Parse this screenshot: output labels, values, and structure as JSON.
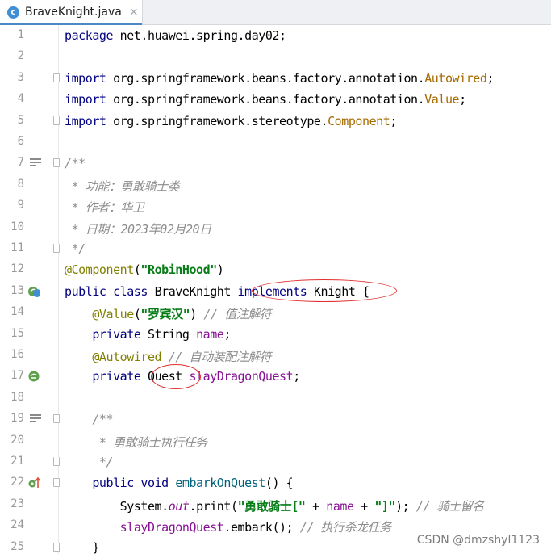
{
  "tab": {
    "icon_letter": "c",
    "filename": "BraveKnight.java",
    "close": "×"
  },
  "lines": [
    {
      "n": "1",
      "code": [
        [
          "kw",
          "package"
        ],
        [
          "plain",
          " net.huawei.spring.day02;"
        ]
      ]
    },
    {
      "n": "2",
      "code": []
    },
    {
      "n": "3",
      "code": [
        [
          "kw",
          "import"
        ],
        [
          "plain",
          " org.springframework.beans.factory.annotation."
        ],
        [
          "cls",
          "Autowired"
        ],
        [
          "plain",
          ";"
        ]
      ],
      "fold": "start"
    },
    {
      "n": "4",
      "code": [
        [
          "kw",
          "import"
        ],
        [
          "plain",
          " org.springframework.beans.factory.annotation."
        ],
        [
          "cls",
          "Value"
        ],
        [
          "plain",
          ";"
        ]
      ]
    },
    {
      "n": "5",
      "code": [
        [
          "kw",
          "import"
        ],
        [
          "plain",
          " org.springframework.stereotype."
        ],
        [
          "cls",
          "Component"
        ],
        [
          "plain",
          ";"
        ]
      ],
      "fold": "end"
    },
    {
      "n": "6",
      "code": []
    },
    {
      "n": "7",
      "code": [
        [
          "cmt",
          "/**"
        ]
      ],
      "fold": "start",
      "gutter": "doc"
    },
    {
      "n": "8",
      "code": [
        [
          "cmt",
          " * 功能：勇敢骑士类"
        ]
      ]
    },
    {
      "n": "9",
      "code": [
        [
          "cmt",
          " * 作者：华卫"
        ]
      ]
    },
    {
      "n": "10",
      "code": [
        [
          "cmt",
          " * 日期：2023年02月20日"
        ]
      ]
    },
    {
      "n": "11",
      "code": [
        [
          "cmt",
          " */"
        ]
      ],
      "fold": "end"
    },
    {
      "n": "12",
      "code": [
        [
          "ann",
          "@Component"
        ],
        [
          "plain",
          "("
        ],
        [
          "str",
          "\"RobinHood\""
        ],
        [
          "plain",
          ")"
        ]
      ]
    },
    {
      "n": "13",
      "code": [
        [
          "kw",
          "public class"
        ],
        [
          "plain",
          " BraveKnight "
        ],
        [
          "kw",
          "implements"
        ],
        [
          "plain",
          " Knight "
        ],
        [
          "plain",
          "{"
        ]
      ],
      "gutter": "impl"
    },
    {
      "n": "14",
      "code": [
        [
          "plain",
          "    "
        ],
        [
          "ann",
          "@Value"
        ],
        [
          "plain",
          "("
        ],
        [
          "str",
          "\"罗宾汉\""
        ],
        [
          "plain",
          ") "
        ],
        [
          "cmt",
          "// 值注解符"
        ]
      ]
    },
    {
      "n": "15",
      "code": [
        [
          "plain",
          "    "
        ],
        [
          "kw",
          "private"
        ],
        [
          "plain",
          " String "
        ],
        [
          "fld",
          "name"
        ],
        [
          "plain",
          ";"
        ]
      ]
    },
    {
      "n": "16",
      "code": [
        [
          "plain",
          "    "
        ],
        [
          "ann",
          "@Autowired"
        ],
        [
          "plain",
          " "
        ],
        [
          "cmt",
          "// 自动装配注解符"
        ]
      ]
    },
    {
      "n": "17",
      "code": [
        [
          "plain",
          "    "
        ],
        [
          "kw",
          "private"
        ],
        [
          "plain",
          " Quest "
        ],
        [
          "fld",
          "slayDragonQuest"
        ],
        [
          "plain",
          ";"
        ]
      ],
      "gutter": "bean"
    },
    {
      "n": "18",
      "code": []
    },
    {
      "n": "19",
      "code": [
        [
          "plain",
          "    "
        ],
        [
          "cmt",
          "/**"
        ]
      ],
      "fold": "start",
      "gutter": "doc"
    },
    {
      "n": "20",
      "code": [
        [
          "plain",
          "     "
        ],
        [
          "cmt",
          "* 勇敢骑士执行任务"
        ]
      ]
    },
    {
      "n": "21",
      "code": [
        [
          "plain",
          "     "
        ],
        [
          "cmt",
          "*/"
        ]
      ],
      "fold": "end"
    },
    {
      "n": "22",
      "code": [
        [
          "plain",
          "    "
        ],
        [
          "kw",
          "public void"
        ],
        [
          "plain",
          " "
        ],
        [
          "meth",
          "embarkOnQuest"
        ],
        [
          "plain",
          "() {"
        ]
      ],
      "fold": "start",
      "gutter": "override"
    },
    {
      "n": "23",
      "code": [
        [
          "plain",
          "        System."
        ],
        [
          "stat",
          "out"
        ],
        [
          "plain",
          "."
        ],
        [
          "plain",
          "print("
        ],
        [
          "str",
          "\"勇敢骑士[\""
        ],
        [
          "plain",
          " + "
        ],
        [
          "fld",
          "name"
        ],
        [
          "plain",
          " + "
        ],
        [
          "str",
          "\"]\""
        ],
        [
          "plain",
          "); "
        ],
        [
          "cmt",
          "// 骑士留名"
        ]
      ]
    },
    {
      "n": "24",
      "code": [
        [
          "plain",
          "        "
        ],
        [
          "fld",
          "slayDragonQuest"
        ],
        [
          "plain",
          ".embark(); "
        ],
        [
          "cmt",
          "// 执行杀龙任务"
        ]
      ]
    },
    {
      "n": "25",
      "code": [
        [
          "plain",
          "    }"
        ]
      ],
      "fold": "end"
    }
  ],
  "watermark": "CSDN @dmzshyl1123"
}
